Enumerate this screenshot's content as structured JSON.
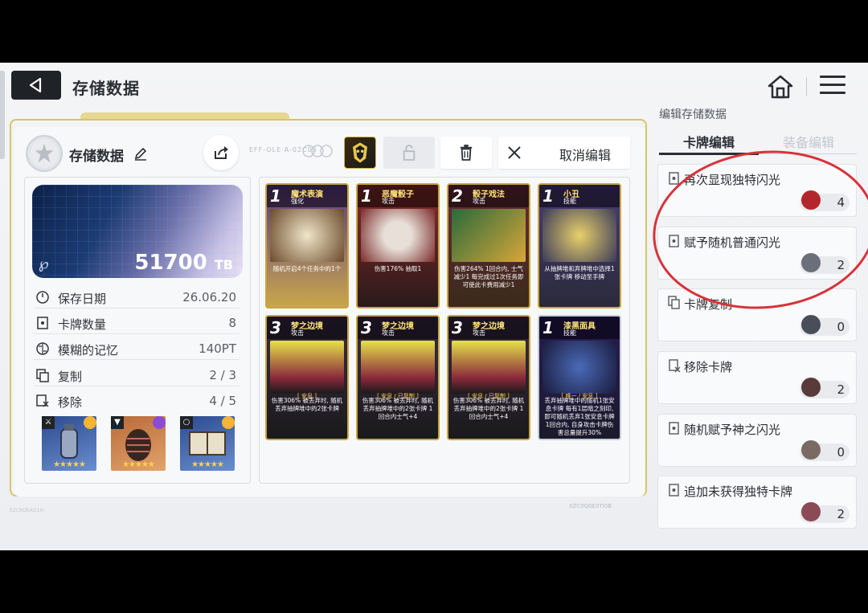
{
  "header": {
    "title": "存储数据"
  },
  "save": {
    "name": "存储数据",
    "code_text": "EFF-OLE·A-02C05",
    "cancel_label": "取消编辑",
    "tb_value": "51700",
    "tb_unit": "TB"
  },
  "stats": [
    {
      "label": "保存日期",
      "value": "26.06.20",
      "icon": "clock-icon"
    },
    {
      "label": "卡牌数量",
      "value": "8",
      "icon": "card-icon"
    },
    {
      "label": "模糊的记忆",
      "value": "140PT",
      "icon": "brain-icon"
    },
    {
      "label": "复制",
      "value": "2 / 3",
      "icon": "copy-icon"
    },
    {
      "label": "移除",
      "value": "4 / 5",
      "icon": "remove-icon"
    }
  ],
  "equipment": [
    {
      "stars": "★★★★★",
      "icon": "weapon-icon"
    },
    {
      "stars": "★★★★★",
      "icon": "armor-icon"
    },
    {
      "stars": "★★★★★",
      "icon": "ring-icon"
    }
  ],
  "cards": [
    {
      "cost": "1",
      "name": "魔术表演",
      "type": "强化",
      "tag": "",
      "desc": "随机开启4个任务中的1个"
    },
    {
      "cost": "1",
      "name": "恶魔骰子",
      "type": "攻击",
      "tag": "",
      "desc": "伤害176% 抽取1"
    },
    {
      "cost": "2",
      "name": "骰子戏法",
      "type": "攻击",
      "tag": "",
      "desc": "伤害264% 1回合内, 士气减少1 每完成过1次任务即可使此卡费用减少1"
    },
    {
      "cost": "1",
      "name": "小丑",
      "type": "技能",
      "tag": "",
      "desc": "从抽牌堆和弃牌堆中选择1张卡牌 移动至手牌"
    },
    {
      "cost": "3",
      "name": "梦之边境",
      "type": "攻击",
      "tag": "[ 安息 ]",
      "desc": "伤害306% 被丢弃时, 随机丢弃抽牌堆中的2张卡牌"
    },
    {
      "cost": "3",
      "name": "梦之边境",
      "type": "攻击",
      "tag": "[ 安息 / 已复制 ]",
      "desc": "伤害306% 被丢弃时, 随机丢弃抽牌堆中的2张卡牌 1回合内士气+4"
    },
    {
      "cost": "3",
      "name": "梦之边境",
      "type": "攻击",
      "tag": "[ 安息 / 已复制 ]",
      "desc": "伤害306% 被丢弃时, 随机丢弃抽牌堆中的2张卡牌 1回合内士气+4"
    },
    {
      "cost": "1",
      "name": "漆黑面具",
      "type": "技能",
      "tag": "[ 唯一 / 安息 ]",
      "desc": "丢弃抽牌堆中的随机1张安息卡牌 每有1层暗之刻印, 即可随机丢弃1张安息卡牌 1回合内, 自身攻击卡牌伤害总量提升30%"
    }
  ],
  "right_panel": {
    "title": "编辑存储数据",
    "tab_active": "卡牌编辑",
    "tab_inactive": "装备编辑",
    "options": [
      {
        "label": "再次显现独特闪光",
        "count": "4",
        "icon_color": "#b3262b"
      },
      {
        "label": "赋予随机普通闪光",
        "count": "2",
        "icon_color": "#6a6f7a"
      },
      {
        "label": "卡牌复制",
        "count": "0",
        "icon_color": "#4a4e58"
      },
      {
        "label": "移除卡牌",
        "count": "2",
        "icon_color": "#5b3a3a"
      },
      {
        "label": "随机赋予神之闪光",
        "count": "0",
        "icon_color": "#7a6a64"
      },
      {
        "label": "追加未获得独特卡牌",
        "count": "2",
        "icon_color": "#8a4a56"
      }
    ]
  },
  "footer": {
    "code": "EZCROEAO1H-",
    "code2": "0ZC0Q0E0TI0B"
  },
  "colors": {
    "accent_gold": "#d9c469",
    "annotation_red": "#d8323a",
    "dark": "#1f2226"
  }
}
